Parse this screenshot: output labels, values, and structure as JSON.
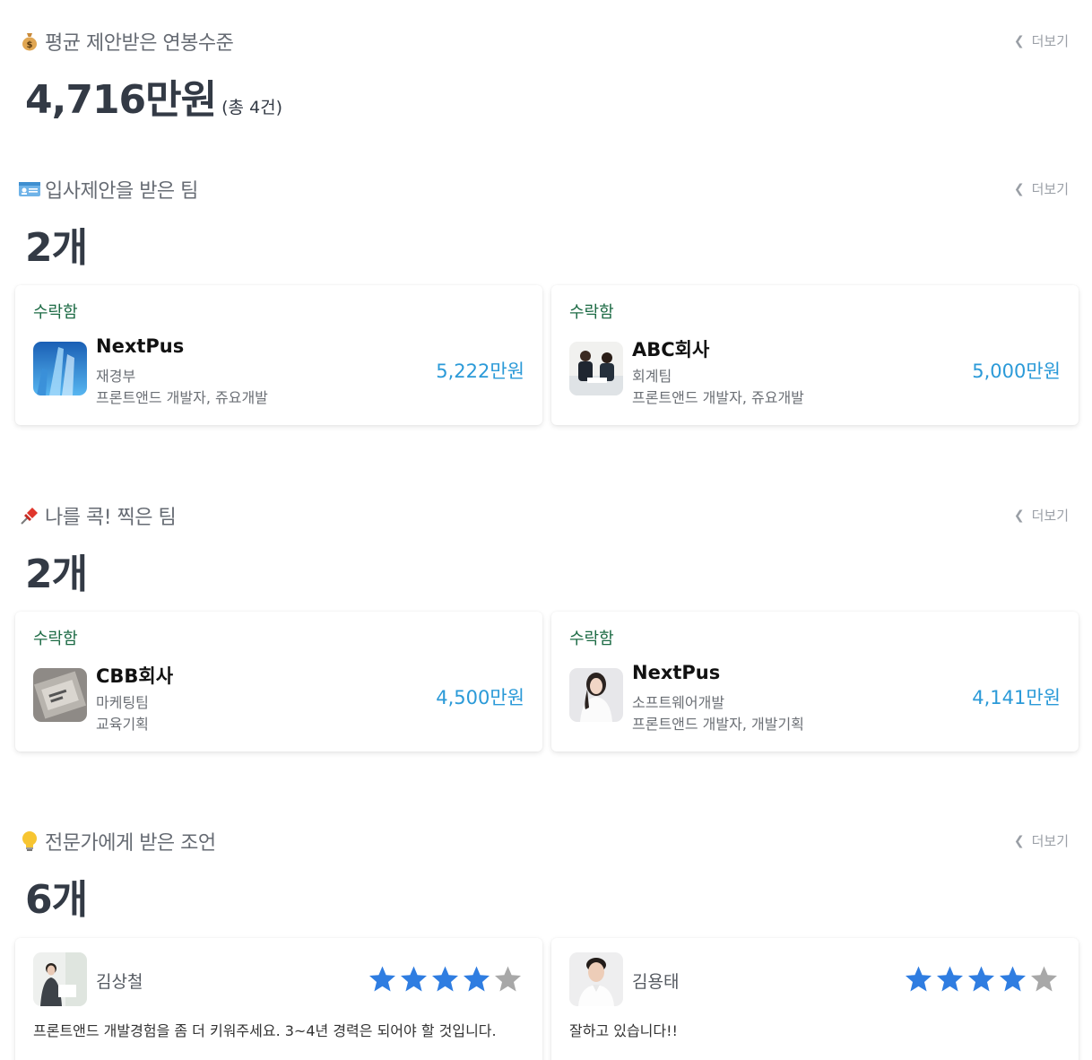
{
  "more_label": "더보기",
  "salary_section": {
    "icon": "money-bag-icon",
    "title": "평균 제안받은 연봉수준",
    "value": "4,716만원",
    "count_note": "(총 4건)"
  },
  "offers_section": {
    "icon": "id-card-icon",
    "title": "입사제안을 받은 팀",
    "count": "2개",
    "cards": [
      {
        "status": "수락함",
        "company": "NextPus",
        "team": "재경부",
        "role": "프론트앤드 개발자, 쥬요개발",
        "salary": "5,222만원"
      },
      {
        "status": "수락함",
        "company": "ABC회사",
        "team": "회계팀",
        "role": "프론트앤드 개발자, 쥬요개발",
        "salary": "5,000만원"
      }
    ]
  },
  "picked_section": {
    "icon": "pushpin-icon",
    "title": "나를 콕! 찍은 팀",
    "count": "2개",
    "cards": [
      {
        "status": "수락함",
        "company": "CBB회사",
        "team": "마케팅팀",
        "role": "교육기획",
        "salary": "4,500만원"
      },
      {
        "status": "수락함",
        "company": "NextPus",
        "team": "소프트웨어개발",
        "role": "프론트앤드 개발자, 개발기획",
        "salary": "4,141만원"
      }
    ]
  },
  "advice_section": {
    "icon": "light-bulb-icon",
    "title": "전문가에게 받은 조언",
    "count": "6개",
    "reviews": [
      {
        "name": "김상철",
        "rating": 4,
        "max_rating": 5,
        "comment": "프론트앤드 개발경험을 좀 더 키워주세요. 3~4년 경력은 되어야 할 것입니다."
      },
      {
        "name": "김용태",
        "rating": 4,
        "max_rating": 5,
        "comment": "잘하고 있습니다!!"
      }
    ]
  },
  "colors": {
    "status_green": "#1d6b45",
    "salary_blue": "#2b9ad8",
    "star_blue": "#2f7de1",
    "star_gray": "#a8a8a8"
  }
}
